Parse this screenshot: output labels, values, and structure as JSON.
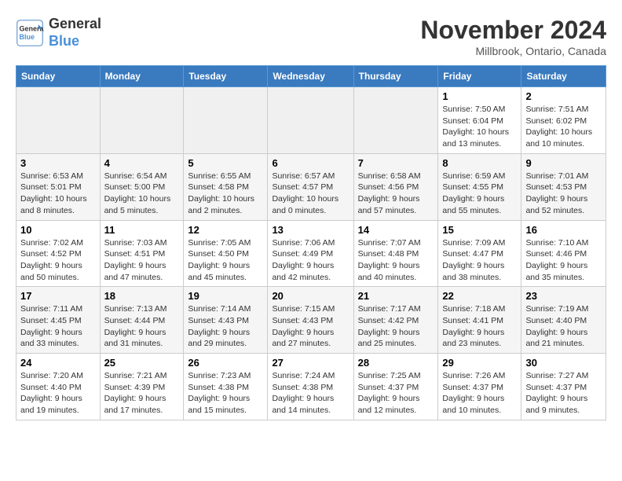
{
  "logo": {
    "line1": "General",
    "line2": "Blue"
  },
  "title": "November 2024",
  "location": "Millbrook, Ontario, Canada",
  "weekdays": [
    "Sunday",
    "Monday",
    "Tuesday",
    "Wednesday",
    "Thursday",
    "Friday",
    "Saturday"
  ],
  "weeks": [
    [
      {
        "day": "",
        "info": ""
      },
      {
        "day": "",
        "info": ""
      },
      {
        "day": "",
        "info": ""
      },
      {
        "day": "",
        "info": ""
      },
      {
        "day": "",
        "info": ""
      },
      {
        "day": "1",
        "info": "Sunrise: 7:50 AM\nSunset: 6:04 PM\nDaylight: 10 hours and 13 minutes."
      },
      {
        "day": "2",
        "info": "Sunrise: 7:51 AM\nSunset: 6:02 PM\nDaylight: 10 hours and 10 minutes."
      }
    ],
    [
      {
        "day": "3",
        "info": "Sunrise: 6:53 AM\nSunset: 5:01 PM\nDaylight: 10 hours and 8 minutes."
      },
      {
        "day": "4",
        "info": "Sunrise: 6:54 AM\nSunset: 5:00 PM\nDaylight: 10 hours and 5 minutes."
      },
      {
        "day": "5",
        "info": "Sunrise: 6:55 AM\nSunset: 4:58 PM\nDaylight: 10 hours and 2 minutes."
      },
      {
        "day": "6",
        "info": "Sunrise: 6:57 AM\nSunset: 4:57 PM\nDaylight: 10 hours and 0 minutes."
      },
      {
        "day": "7",
        "info": "Sunrise: 6:58 AM\nSunset: 4:56 PM\nDaylight: 9 hours and 57 minutes."
      },
      {
        "day": "8",
        "info": "Sunrise: 6:59 AM\nSunset: 4:55 PM\nDaylight: 9 hours and 55 minutes."
      },
      {
        "day": "9",
        "info": "Sunrise: 7:01 AM\nSunset: 4:53 PM\nDaylight: 9 hours and 52 minutes."
      }
    ],
    [
      {
        "day": "10",
        "info": "Sunrise: 7:02 AM\nSunset: 4:52 PM\nDaylight: 9 hours and 50 minutes."
      },
      {
        "day": "11",
        "info": "Sunrise: 7:03 AM\nSunset: 4:51 PM\nDaylight: 9 hours and 47 minutes."
      },
      {
        "day": "12",
        "info": "Sunrise: 7:05 AM\nSunset: 4:50 PM\nDaylight: 9 hours and 45 minutes."
      },
      {
        "day": "13",
        "info": "Sunrise: 7:06 AM\nSunset: 4:49 PM\nDaylight: 9 hours and 42 minutes."
      },
      {
        "day": "14",
        "info": "Sunrise: 7:07 AM\nSunset: 4:48 PM\nDaylight: 9 hours and 40 minutes."
      },
      {
        "day": "15",
        "info": "Sunrise: 7:09 AM\nSunset: 4:47 PM\nDaylight: 9 hours and 38 minutes."
      },
      {
        "day": "16",
        "info": "Sunrise: 7:10 AM\nSunset: 4:46 PM\nDaylight: 9 hours and 35 minutes."
      }
    ],
    [
      {
        "day": "17",
        "info": "Sunrise: 7:11 AM\nSunset: 4:45 PM\nDaylight: 9 hours and 33 minutes."
      },
      {
        "day": "18",
        "info": "Sunrise: 7:13 AM\nSunset: 4:44 PM\nDaylight: 9 hours and 31 minutes."
      },
      {
        "day": "19",
        "info": "Sunrise: 7:14 AM\nSunset: 4:43 PM\nDaylight: 9 hours and 29 minutes."
      },
      {
        "day": "20",
        "info": "Sunrise: 7:15 AM\nSunset: 4:43 PM\nDaylight: 9 hours and 27 minutes."
      },
      {
        "day": "21",
        "info": "Sunrise: 7:17 AM\nSunset: 4:42 PM\nDaylight: 9 hours and 25 minutes."
      },
      {
        "day": "22",
        "info": "Sunrise: 7:18 AM\nSunset: 4:41 PM\nDaylight: 9 hours and 23 minutes."
      },
      {
        "day": "23",
        "info": "Sunrise: 7:19 AM\nSunset: 4:40 PM\nDaylight: 9 hours and 21 minutes."
      }
    ],
    [
      {
        "day": "24",
        "info": "Sunrise: 7:20 AM\nSunset: 4:40 PM\nDaylight: 9 hours and 19 minutes."
      },
      {
        "day": "25",
        "info": "Sunrise: 7:21 AM\nSunset: 4:39 PM\nDaylight: 9 hours and 17 minutes."
      },
      {
        "day": "26",
        "info": "Sunrise: 7:23 AM\nSunset: 4:38 PM\nDaylight: 9 hours and 15 minutes."
      },
      {
        "day": "27",
        "info": "Sunrise: 7:24 AM\nSunset: 4:38 PM\nDaylight: 9 hours and 14 minutes."
      },
      {
        "day": "28",
        "info": "Sunrise: 7:25 AM\nSunset: 4:37 PM\nDaylight: 9 hours and 12 minutes."
      },
      {
        "day": "29",
        "info": "Sunrise: 7:26 AM\nSunset: 4:37 PM\nDaylight: 9 hours and 10 minutes."
      },
      {
        "day": "30",
        "info": "Sunrise: 7:27 AM\nSunset: 4:37 PM\nDaylight: 9 hours and 9 minutes."
      }
    ]
  ]
}
